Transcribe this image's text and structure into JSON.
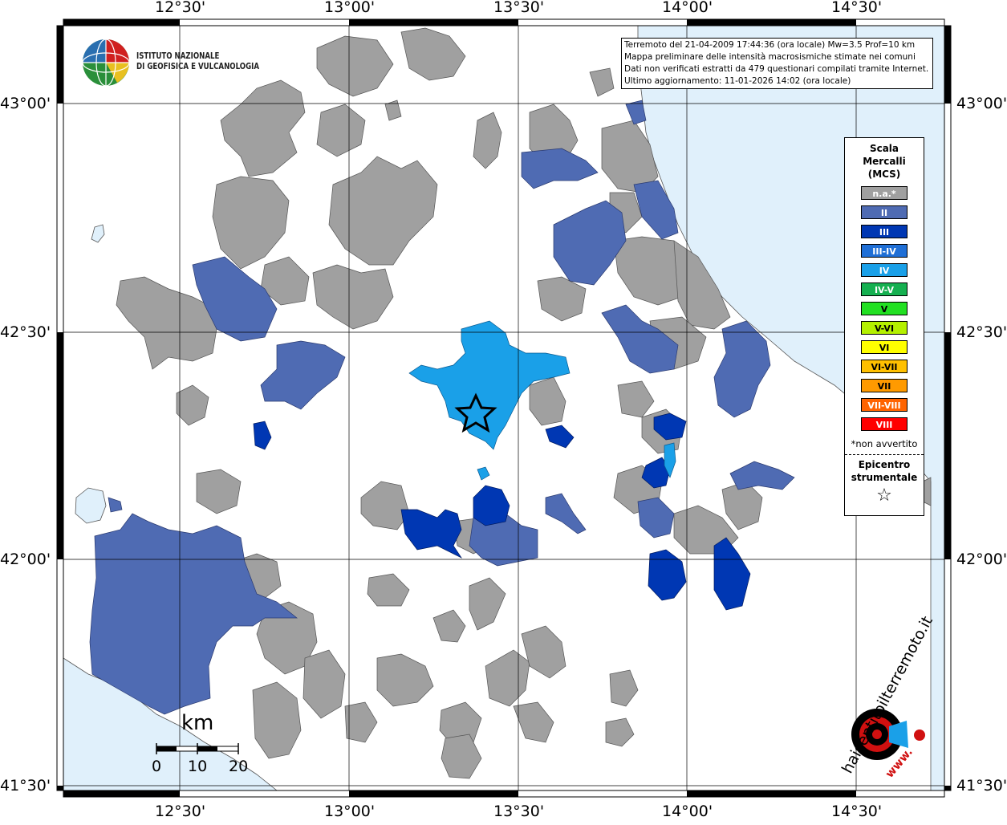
{
  "info": {
    "line1": "Terremoto del 21-04-2009 17:44:36 (ora locale) Mw=3.5 Prof=10 km",
    "line2": "Mappa preliminare delle intensità macrosismiche stimate nei comuni",
    "line3": "Dati non verificati estratti da 479 questionari compilati tramite Internet.",
    "line4": "Ultimo aggiornamento: 11-01-2026 14:02 (ora locale)"
  },
  "logo": {
    "line1": "ISTITUTO NAZIONALE",
    "line2": "DI GEOFISICA E VULCANOLOGIA",
    "icon": "ingv-globe-icon"
  },
  "axes": {
    "top": [
      "12°30'",
      "13°00'",
      "13°30'",
      "14°00'",
      "14°30'"
    ],
    "bottom": [
      "12°30'",
      "13°00'",
      "13°30'",
      "14°00'",
      "14°30'"
    ],
    "left": [
      "43°00'",
      "42°30'",
      "42°00'",
      "41°30'"
    ],
    "right": [
      "43°00'",
      "42°30'",
      "42°00'",
      "41°30'"
    ]
  },
  "legend": {
    "title_lines": [
      "Scala",
      "Mercalli",
      "(MCS)"
    ],
    "items": [
      {
        "label": "n.a.*",
        "color": "#a0a0a0"
      },
      {
        "label": "II",
        "color": "#4f6bb3"
      },
      {
        "label": "III",
        "color": "#0037b3"
      },
      {
        "label": "III-IV",
        "color": "#1f6fd6"
      },
      {
        "label": "IV",
        "color": "#1aa0e8"
      },
      {
        "label": "IV-V",
        "color": "#15b050"
      },
      {
        "label": "V",
        "color": "#22e022"
      },
      {
        "label": "V-VI",
        "color": "#b4f000"
      },
      {
        "label": "VI",
        "color": "#ffff00"
      },
      {
        "label": "VI-VII",
        "color": "#ffc000"
      },
      {
        "label": "VII",
        "color": "#ff9a00"
      },
      {
        "label": "VII-VIII",
        "color": "#ff6400"
      },
      {
        "label": "VIII",
        "color": "#ff0000"
      }
    ],
    "note": "*non avvertito",
    "epicenter_lines": [
      "Epicentro",
      "strumentale"
    ],
    "epicenter_icon": "star-icon"
  },
  "scale_bar": {
    "unit": "km",
    "ticks": [
      "0",
      "10",
      "20"
    ]
  },
  "watermark": {
    "text": "haisentitoilterremoto.it",
    "url_text": "www."
  },
  "colors": {
    "sea": "#e0f0fb",
    "land": "#ffffff",
    "na": "#a0a0a0",
    "ii": "#4f6bb3",
    "iii": "#0037b3",
    "iv": "#1aa0e8",
    "grid": "#000000"
  }
}
